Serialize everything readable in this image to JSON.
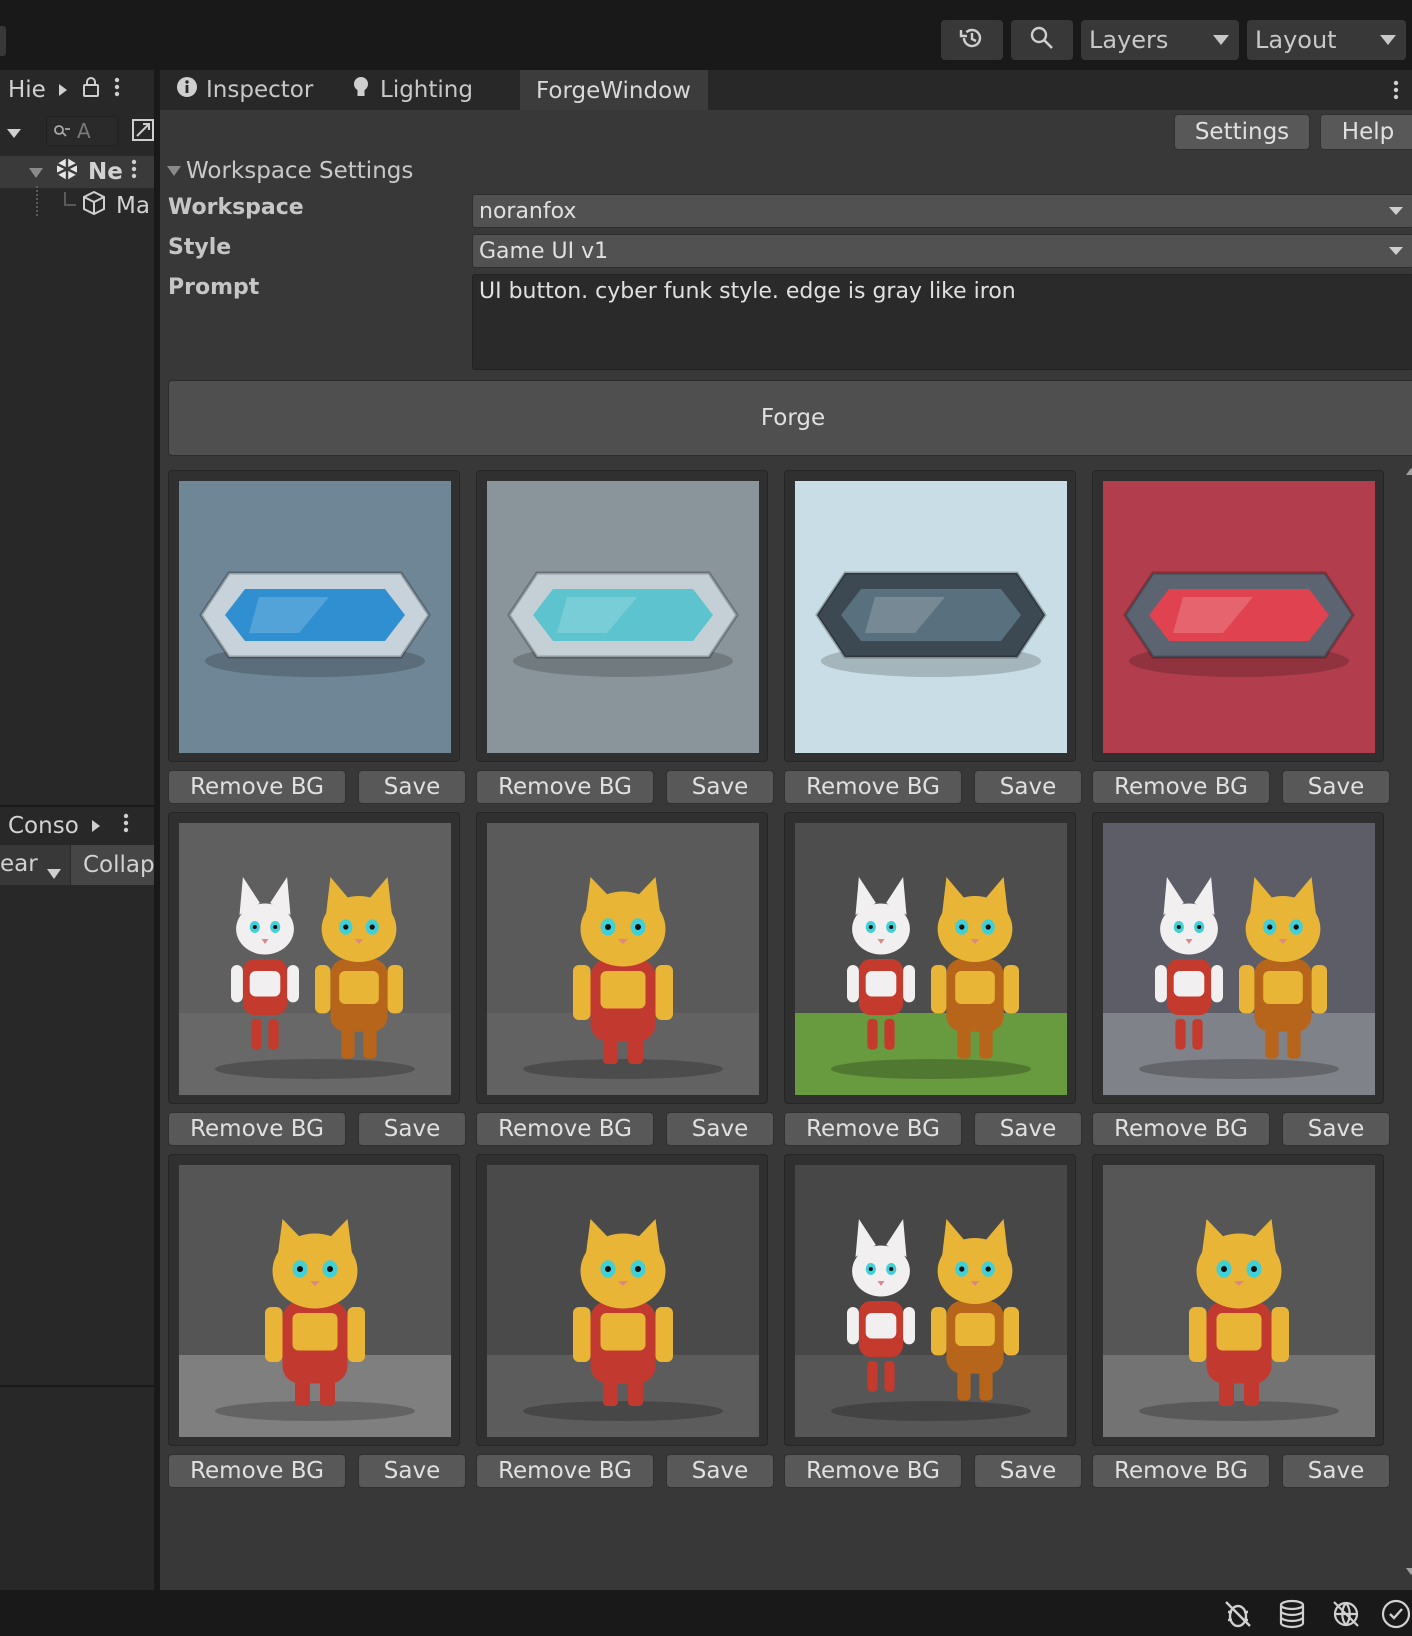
{
  "toolbar": {
    "history_icon": "history-icon",
    "search_icon": "search-icon",
    "layers_label": "Layers",
    "layout_label": "Layout"
  },
  "hierarchy": {
    "title": "Hie",
    "search_placeholder": "A",
    "items": [
      {
        "label": "Ne",
        "icon": "unity-scene-icon"
      },
      {
        "label": "Ma",
        "icon": "cube-icon"
      }
    ]
  },
  "console": {
    "title": "Conso",
    "clear_label": "ear",
    "collapse_label": "Collap"
  },
  "tabs": [
    {
      "label": "Inspector",
      "icon": "info-icon"
    },
    {
      "label": "Lighting",
      "icon": "bulb-icon"
    },
    {
      "label": "ForgeWindow",
      "active": true
    }
  ],
  "forge": {
    "settings_label": "Settings",
    "help_label": "Help",
    "section_title": "Workspace Settings",
    "workspace_label": "Workspace",
    "workspace_value": "noranfox",
    "style_label": "Style",
    "style_value": "Game UI v1",
    "prompt_label": "Prompt",
    "prompt_value": "UI button. cyber funk style. edge is gray like iron",
    "forge_label": "Forge",
    "remove_bg_label": "Remove BG",
    "save_label": "Save"
  },
  "results": [
    {
      "kind": "button",
      "bg": "#6f8696",
      "frame": "#c7d2db",
      "inner": "#2f8fd0"
    },
    {
      "kind": "button",
      "bg": "#8a959b",
      "frame": "#c4d0d6",
      "inner": "#5cc3cf"
    },
    {
      "kind": "button",
      "bg": "#c8dde6",
      "frame": "#3c4852",
      "inner": "#59707e"
    },
    {
      "kind": "button",
      "bg": "#b13d4d",
      "frame": "#5b6470",
      "inner": "#e0424f"
    },
    {
      "kind": "cats",
      "bg": "#5f5f5f",
      "ground": "#6a6a6a",
      "count": 2
    },
    {
      "kind": "cats",
      "bg": "#5a5a5a",
      "ground": "#646464",
      "count": 1
    },
    {
      "kind": "cats",
      "bg": "#4d4d4d",
      "ground": "#6fae3c",
      "count": 2
    },
    {
      "kind": "cats",
      "bg": "#5c5d66",
      "ground": "#8a8c94",
      "count": 2
    },
    {
      "kind": "cats",
      "bg": "#555555",
      "ground": "#8a8a8a",
      "count": 1
    },
    {
      "kind": "cats",
      "bg": "#4a4a4a",
      "ground": "#606060",
      "count": 1
    },
    {
      "kind": "cats",
      "bg": "#474747",
      "ground": "#5a5a5a",
      "count": 2
    },
    {
      "kind": "cats",
      "bg": "#565656",
      "ground": "#7a7a7a",
      "count": 1
    }
  ],
  "statusbar": {
    "icons": [
      "debug-off-icon",
      "database-icon",
      "network-off-icon",
      "check-circle-icon"
    ]
  }
}
